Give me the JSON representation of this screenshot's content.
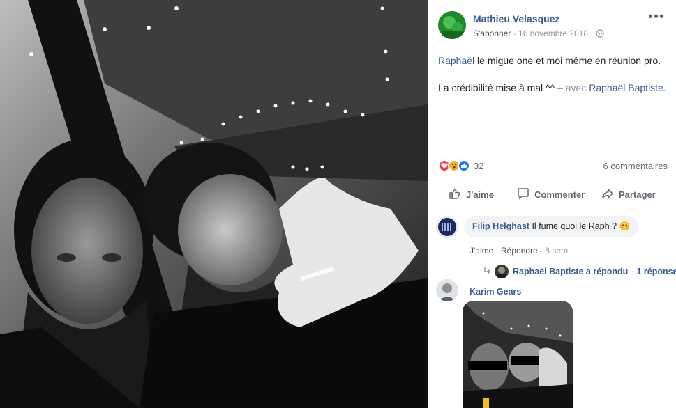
{
  "post": {
    "author": "Mathieu Velasquez",
    "follow_label": "S'abonner",
    "separator": "·",
    "date": "16 novembre 2018",
    "more_label": "•••",
    "text_line1_mention": "Raphaël",
    "text_line1_rest": " le migue one et moi même en réunion pro.",
    "text_line2": "La crédibilité mise à mal ^^",
    "with_prefix": " – avec ",
    "with_mention": "Raphaël Baptiste",
    "with_suffix": ".",
    "reaction_count": "32",
    "comment_count": "6 commentaires",
    "reaction_icons": [
      "like-icon",
      "wow-icon",
      "love-icon"
    ]
  },
  "actions": {
    "like": "J'aime",
    "comment": "Commenter",
    "share": "Partager"
  },
  "comments": [
    {
      "author": "Filip Helghast",
      "text": "Il fume quoi le Raph ? 😊",
      "like": "J'aime",
      "reply": "Répondre",
      "time": "8 sem",
      "dot": "·",
      "reply_summary": "Raphaël Baptiste a répondu",
      "reply_count": "1 réponse"
    },
    {
      "author": "Karim Gears"
    }
  ],
  "colors": {
    "link": "#385898",
    "like_blue": "#1877f2",
    "love_red": "#f33e58",
    "wow_yellow": "#f7b125",
    "muted": "#90949c"
  }
}
